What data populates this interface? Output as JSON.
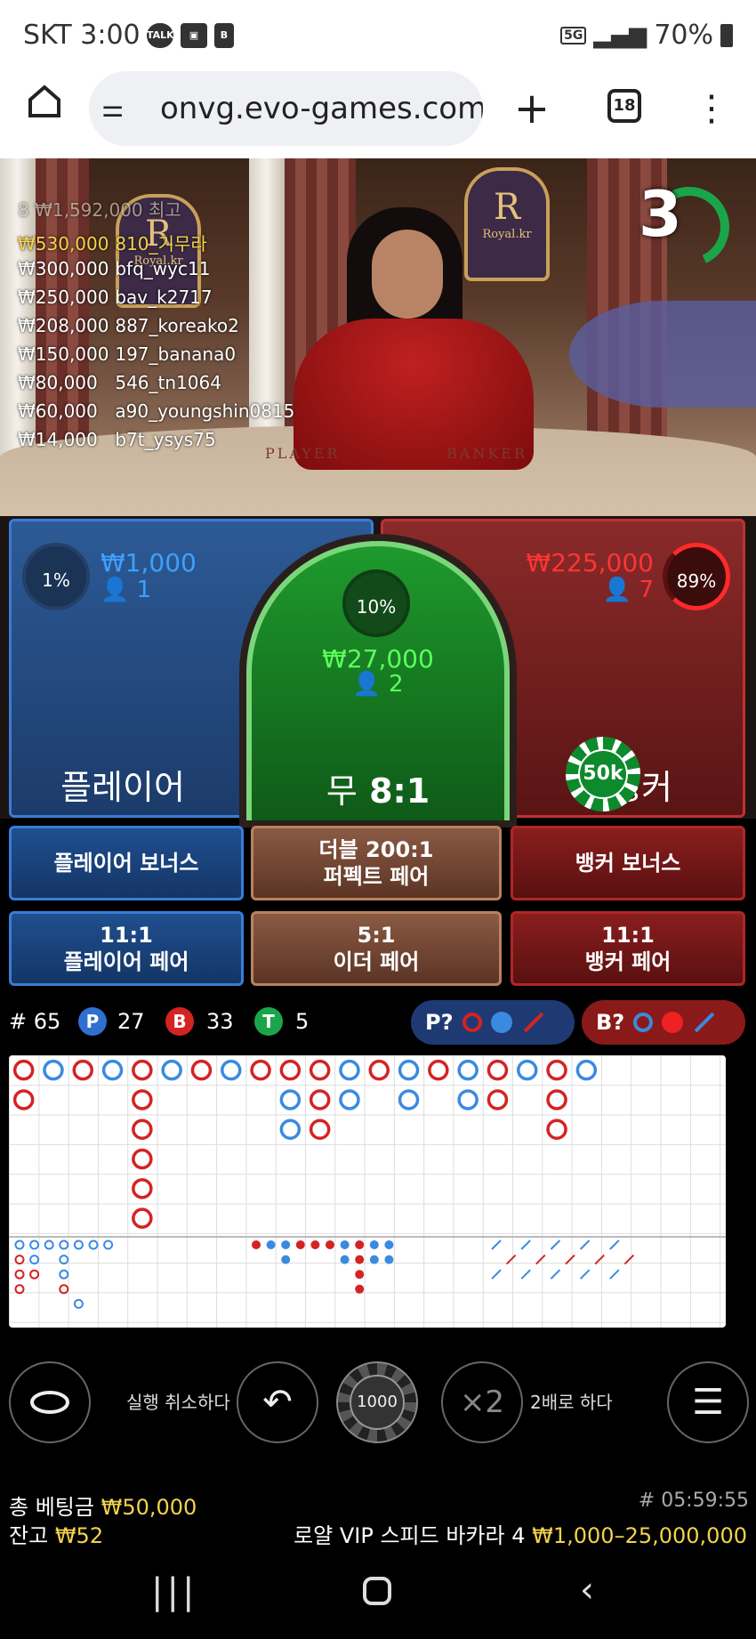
{
  "status_bar": {
    "carrier_time": "SKT 3:00",
    "battery": "70%",
    "network": "5G"
  },
  "browser": {
    "url": "onvg.evo-games.com",
    "tab_count": "18"
  },
  "leaderboard": {
    "header": "8 ₩1,592,000 최고",
    "entries": [
      {
        "amount": "₩530,000",
        "user": "810_기무라"
      },
      {
        "amount": "₩300,000",
        "user": "bfq_wyc11"
      },
      {
        "amount": "₩250,000",
        "user": "bav_k2717"
      },
      {
        "amount": "₩208,000",
        "user": "887_koreako2"
      },
      {
        "amount": "₩150,000",
        "user": "197_banana0"
      },
      {
        "amount": "₩80,000",
        "user": "546_tn1064"
      },
      {
        "amount": "₩60,000",
        "user": "a90_youngshin0815"
      },
      {
        "amount": "₩14,000",
        "user": "b7t_ysys75"
      }
    ]
  },
  "countdown": "3",
  "table_labels": {
    "player": "PLAYER",
    "banker": "BANKER",
    "brand": "Royal.kr"
  },
  "bets": {
    "player": {
      "pct": "1%",
      "amount": "₩1,000",
      "count": "1",
      "label": "플레이어"
    },
    "tie": {
      "pct": "10%",
      "amount": "₩27,000",
      "count": "2",
      "label": "무",
      "odds": "8:1"
    },
    "banker": {
      "pct": "89%",
      "amount": "₩225,000",
      "count": "7",
      "label": "뱅커"
    },
    "chip_value": "50k"
  },
  "side_bets": {
    "player_bonus": "플레이어 보너스",
    "perfect_pair_line1": "더블 200:1",
    "perfect_pair_line2": "퍼펙트 페어",
    "banker_bonus": "뱅커 보너스",
    "player_pair_line1": "11:1",
    "player_pair_line2": "플레이어 페어",
    "either_pair_line1": "5:1",
    "either_pair_line2": "이더 페어",
    "banker_pair_line1": "11:1",
    "banker_pair_line2": "뱅커 페어"
  },
  "stats": {
    "round": "# 65",
    "p_label": "P",
    "p": "27",
    "b_label": "B",
    "b": "33",
    "t_label": "T",
    "t": "5",
    "p_predict": "P?",
    "b_predict": "B?"
  },
  "colors": {
    "player": "#2f6fcf",
    "banker": "#d42323",
    "tie": "#1ba54a",
    "accent": "#f3d34a"
  },
  "controls": {
    "undo_label": "실행 취소하다",
    "chip_value": "1000",
    "double_icon": "×2",
    "double_label": "2배로 하다"
  },
  "footer": {
    "total_bet_label": "총 베팅금",
    "total_bet": "₩50,000",
    "balance_label": "잔고",
    "balance": "₩52",
    "round_id": "# 05:59:55",
    "table_name": "로얄 VIP 스피드 바카라 4",
    "limits": "₩1,000–25,000,000"
  }
}
